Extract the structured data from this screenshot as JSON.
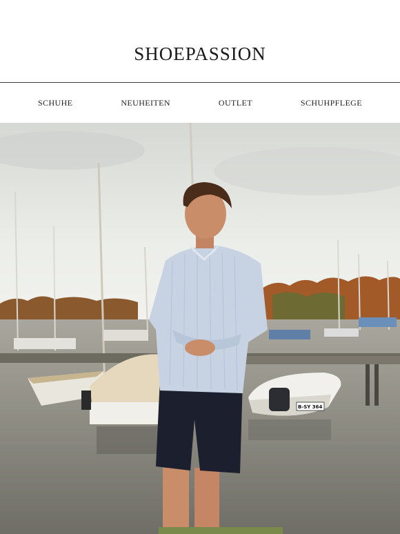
{
  "header": {
    "logo_text": "SHOEPASSION"
  },
  "nav": {
    "items": [
      {
        "label": "SCHUHE"
      },
      {
        "label": "NEUHEITEN"
      },
      {
        "label": "OUTLET"
      },
      {
        "label": "SCHUHPFLEGE"
      }
    ]
  },
  "hero": {
    "boat_registration": "B-SY 364",
    "colors": {
      "sky": "#e9ebe8",
      "water": "#8c8b82",
      "trees": "#b35a2a",
      "shirt": "#c7d3e3",
      "shorts": "#1b1f2e",
      "skin": "#c98d6a",
      "hair": "#4a2c1a"
    }
  }
}
